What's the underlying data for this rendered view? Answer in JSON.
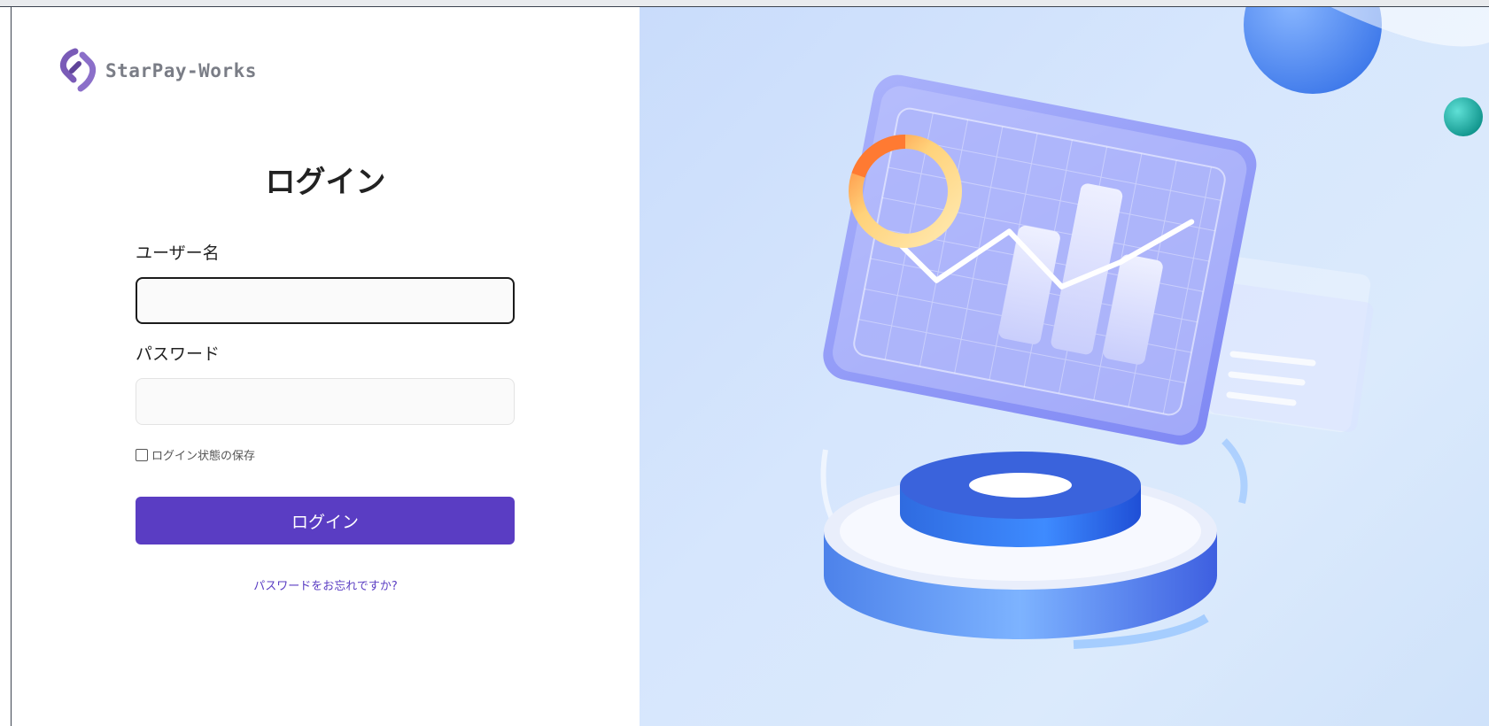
{
  "brand": {
    "name": "StarPay-Works"
  },
  "login": {
    "title": "ログイン",
    "username_label": "ユーザー名",
    "username_value": "",
    "password_label": "パスワード",
    "password_value": "",
    "remember_label": "ログイン状態の保存",
    "remember_checked": false,
    "submit_label": "ログイン",
    "forgot_label": "パスワードをお忘れですか?"
  },
  "colors": {
    "primary": "#5a3dc3",
    "logo_purple": "#7a5bb7",
    "illustration_background": "#d6e6fd"
  },
  "icons": {
    "logo": "starpay-logo-icon",
    "illustration": "dashboard-chart-illustration"
  }
}
